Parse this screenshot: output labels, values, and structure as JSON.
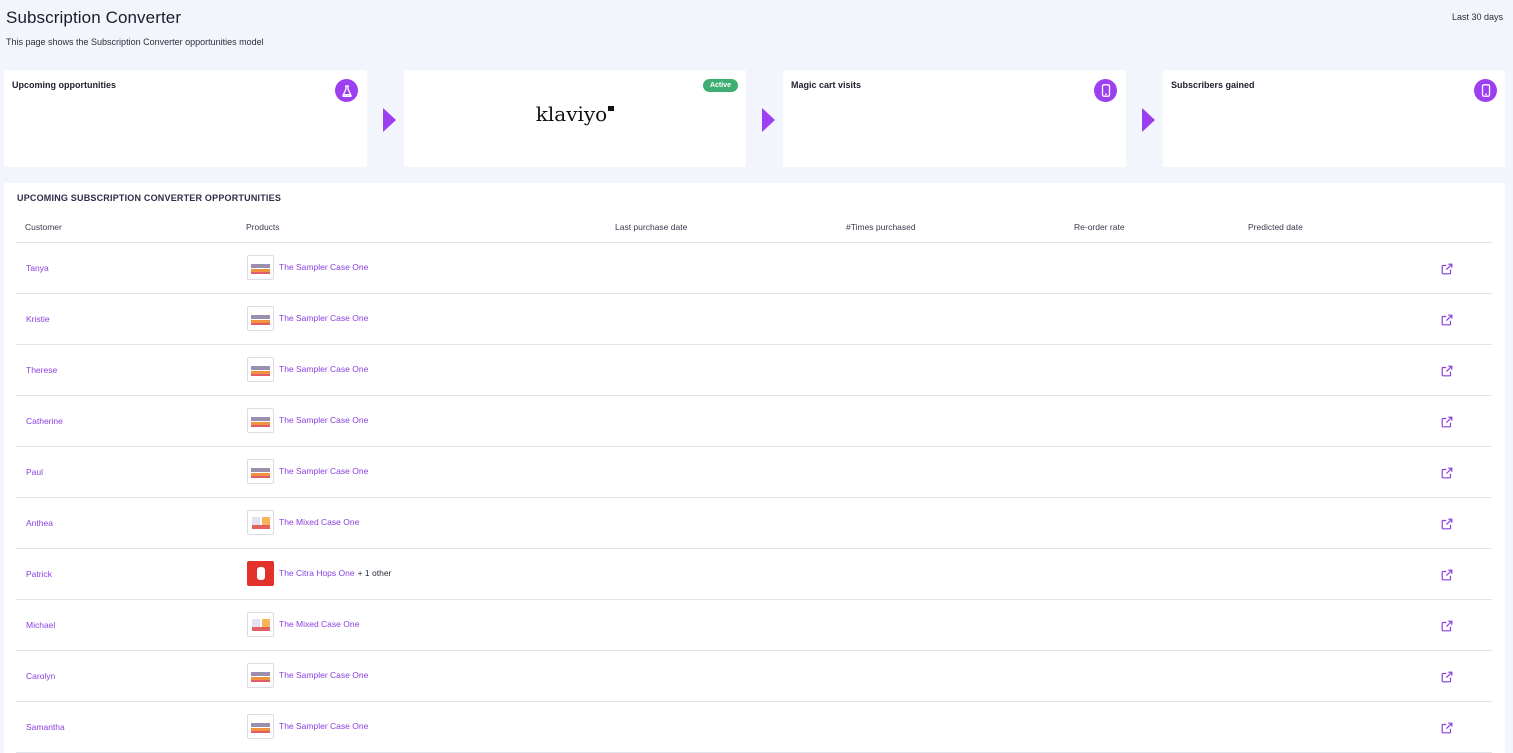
{
  "header": {
    "title": "Subscription Converter",
    "subtitle": "This page shows the Subscription Converter opportunities model",
    "date_range": "Last 30 days"
  },
  "cards": [
    {
      "label": "Upcoming opportunities",
      "icon": "flask-icon"
    },
    {
      "logo_text": "klaviyo",
      "badge": "Active"
    },
    {
      "label": "Magic cart visits",
      "icon": "mobile-icon"
    },
    {
      "label": "Subscribers gained",
      "icon": "mobile-icon"
    }
  ],
  "colors": {
    "accent": "#9b3ff0",
    "link": "#8a3fe0",
    "badge": "#3fae73"
  },
  "table": {
    "heading": "UPCOMING SUBSCRIPTION CONVERTER OPPORTUNITIES",
    "columns": [
      "Customer",
      "Products",
      "Last purchase date",
      "#Times purchased",
      "Re-order rate",
      "Predicted date"
    ],
    "rows": [
      {
        "customer": "Tanya",
        "product": "The Sampler Case One",
        "extra": ""
      },
      {
        "customer": "Kristie",
        "product": "The Sampler Case One",
        "extra": ""
      },
      {
        "customer": "Therese",
        "product": "The Sampler Case One",
        "extra": ""
      },
      {
        "customer": "Catherine",
        "product": "The Sampler Case One",
        "extra": ""
      },
      {
        "customer": "Paul",
        "product": "The Sampler Case One",
        "extra": ""
      },
      {
        "customer": "Anthea",
        "product": "The Mixed Case One",
        "extra": ""
      },
      {
        "customer": "Patrick",
        "product": "The Citra Hops One",
        "extra": "+ 1 other"
      },
      {
        "customer": "Michael",
        "product": "The Mixed Case One",
        "extra": ""
      },
      {
        "customer": "Carolyn",
        "product": "The Sampler Case One",
        "extra": ""
      },
      {
        "customer": "Samantha",
        "product": "The Sampler Case One",
        "extra": ""
      }
    ]
  }
}
